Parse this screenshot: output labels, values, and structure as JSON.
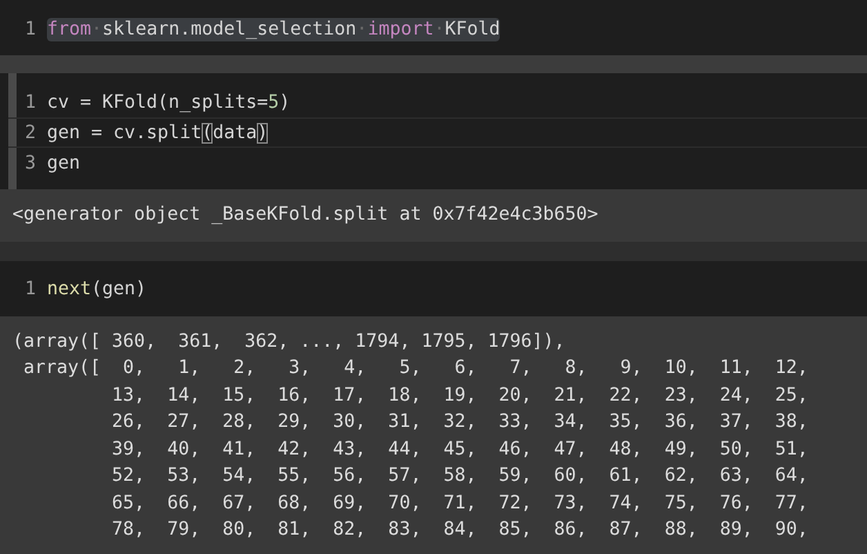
{
  "cells": [
    {
      "active": false,
      "lines": [
        {
          "number": "1",
          "current": false,
          "selected": true,
          "tokens": [
            {
              "kind": "keyword",
              "text": "from"
            },
            {
              "kind": "space",
              "text": "·"
            },
            {
              "kind": "plain",
              "text": "sklearn.model_selection"
            },
            {
              "kind": "space",
              "text": "·"
            },
            {
              "kind": "keyword",
              "text": "import"
            },
            {
              "kind": "space",
              "text": "·"
            },
            {
              "kind": "plain",
              "text": "KFold"
            }
          ]
        }
      ]
    },
    {
      "active": true,
      "lines": [
        {
          "number": "1",
          "current": false,
          "selected": false,
          "tokens": [
            {
              "kind": "plain",
              "text": "cv = KFold(n_splits="
            },
            {
              "kind": "number",
              "text": "5"
            },
            {
              "kind": "plain",
              "text": ")"
            }
          ]
        },
        {
          "number": "2",
          "current": true,
          "selected": false,
          "tokens": [
            {
              "kind": "plain",
              "text": "gen = cv.split"
            },
            {
              "kind": "bracket",
              "text": "("
            },
            {
              "kind": "plain",
              "text": "data"
            },
            {
              "kind": "bracket",
              "text": ")"
            }
          ]
        },
        {
          "number": "3",
          "current": false,
          "selected": false,
          "tokens": [
            {
              "kind": "plain",
              "text": "gen"
            }
          ]
        }
      ],
      "output": [
        "<generator object _BaseKFold.split at 0x7f42e4c3b650>"
      ]
    },
    {
      "active": false,
      "lines": [
        {
          "number": "1",
          "current": false,
          "selected": false,
          "tokens": [
            {
              "kind": "builtin",
              "text": "next"
            },
            {
              "kind": "plain",
              "text": "(gen)"
            }
          ]
        }
      ],
      "output": [
        "(array([ 360,  361,  362, ..., 1794, 1795, 1796]),",
        " array([  0,   1,   2,   3,   4,   5,   6,   7,   8,   9,  10,  11,  12,",
        "         13,  14,  15,  16,  17,  18,  19,  20,  21,  22,  23,  24,  25,",
        "         26,  27,  28,  29,  30,  31,  32,  33,  34,  35,  36,  37,  38,",
        "         39,  40,  41,  42,  43,  44,  45,  46,  47,  48,  49,  50,  51,",
        "         52,  53,  54,  55,  56,  57,  58,  59,  60,  61,  62,  63,  64,",
        "         65,  66,  67,  68,  69,  70,  71,  72,  73,  74,  75,  76,  77,",
        "         78,  79,  80,  81,  82,  83,  84,  85,  86,  87,  88,  89,  90,"
      ]
    }
  ]
}
